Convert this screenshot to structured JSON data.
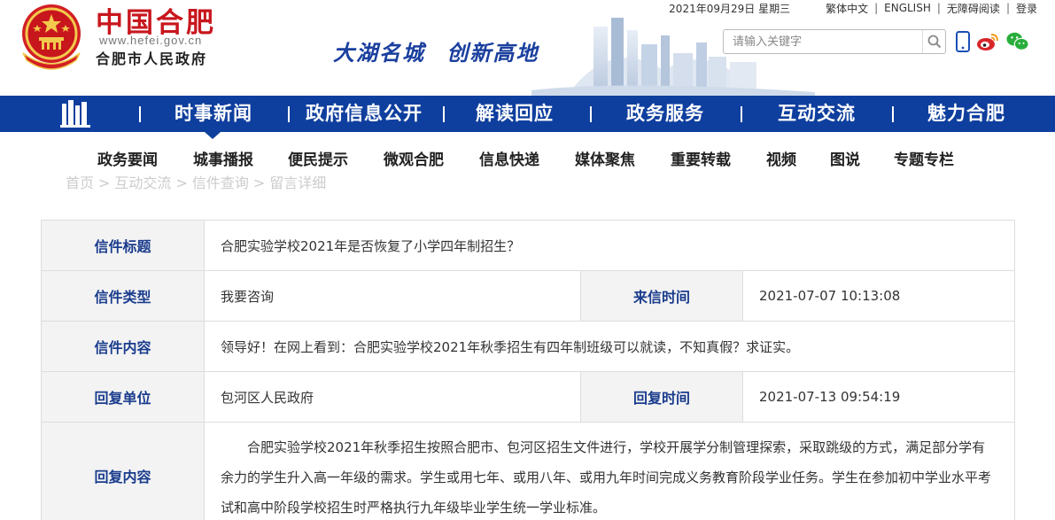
{
  "header": {
    "site_title": "中国合肥",
    "site_url": "www.hefei.gov.cn",
    "site_subtitle": "合肥市人民政府",
    "slogan_part1": "大湖名城",
    "slogan_part2": "创新高地",
    "date": "2021年09月29日 星期三",
    "links": [
      "繁体中文",
      "ENGLISH",
      "无障碍阅读",
      "登录"
    ],
    "search_placeholder": "请输入关键字",
    "colors": {
      "brand_red": "#c8161d",
      "nav_blue": "#0f3f9e",
      "label_blue": "#1a3c8d"
    }
  },
  "main_nav": {
    "items": [
      "时事新闻",
      "政府信息公开",
      "解读回应",
      "政务服务",
      "互动交流",
      "魅力合肥"
    ],
    "active": "时事新闻"
  },
  "sub_nav": {
    "items": [
      "政务要闻",
      "城事播报",
      "便民提示",
      "微观合肥",
      "信息快递",
      "媒体聚焦",
      "重要转载",
      "视频",
      "图说",
      "专题专栏"
    ]
  },
  "breadcrumb": [
    "首页",
    "互动交流",
    "信件查询",
    "留言详细"
  ],
  "letter": {
    "title_label": "信件标题",
    "title_value": "合肥实验学校2021年是否恢复了小学四年制招生？",
    "type_label": "信件类型",
    "type_value": "我要咨询",
    "time_label": "来信时间",
    "time_value": "2021-07-07 10:13:08",
    "content_label": "信件内容",
    "content_value": "领导好！在网上看到：合肥实验学校2021年秋季招生有四年制班级可以就读，不知真假？求证实。",
    "unit_label": "回复单位",
    "unit_value": "包河区人民政府",
    "reply_time_label": "回复时间",
    "reply_time_value": "2021-07-13 09:54:19",
    "reply_label": "回复内容",
    "reply_value": "合肥实验学校2021年秋季招生按照合肥市、包河区招生文件进行，学校开展学分制管理探索，采取跳级的方式，满足部分学有余力的学生升入高一年级的需求。学生或用七年、或用八年、或用九年时间完成义务教育阶段学业任务。学生在参加初中学业水平考试和高中阶段学校招生时严格执行九年级毕业学生统一学业标准。"
  }
}
